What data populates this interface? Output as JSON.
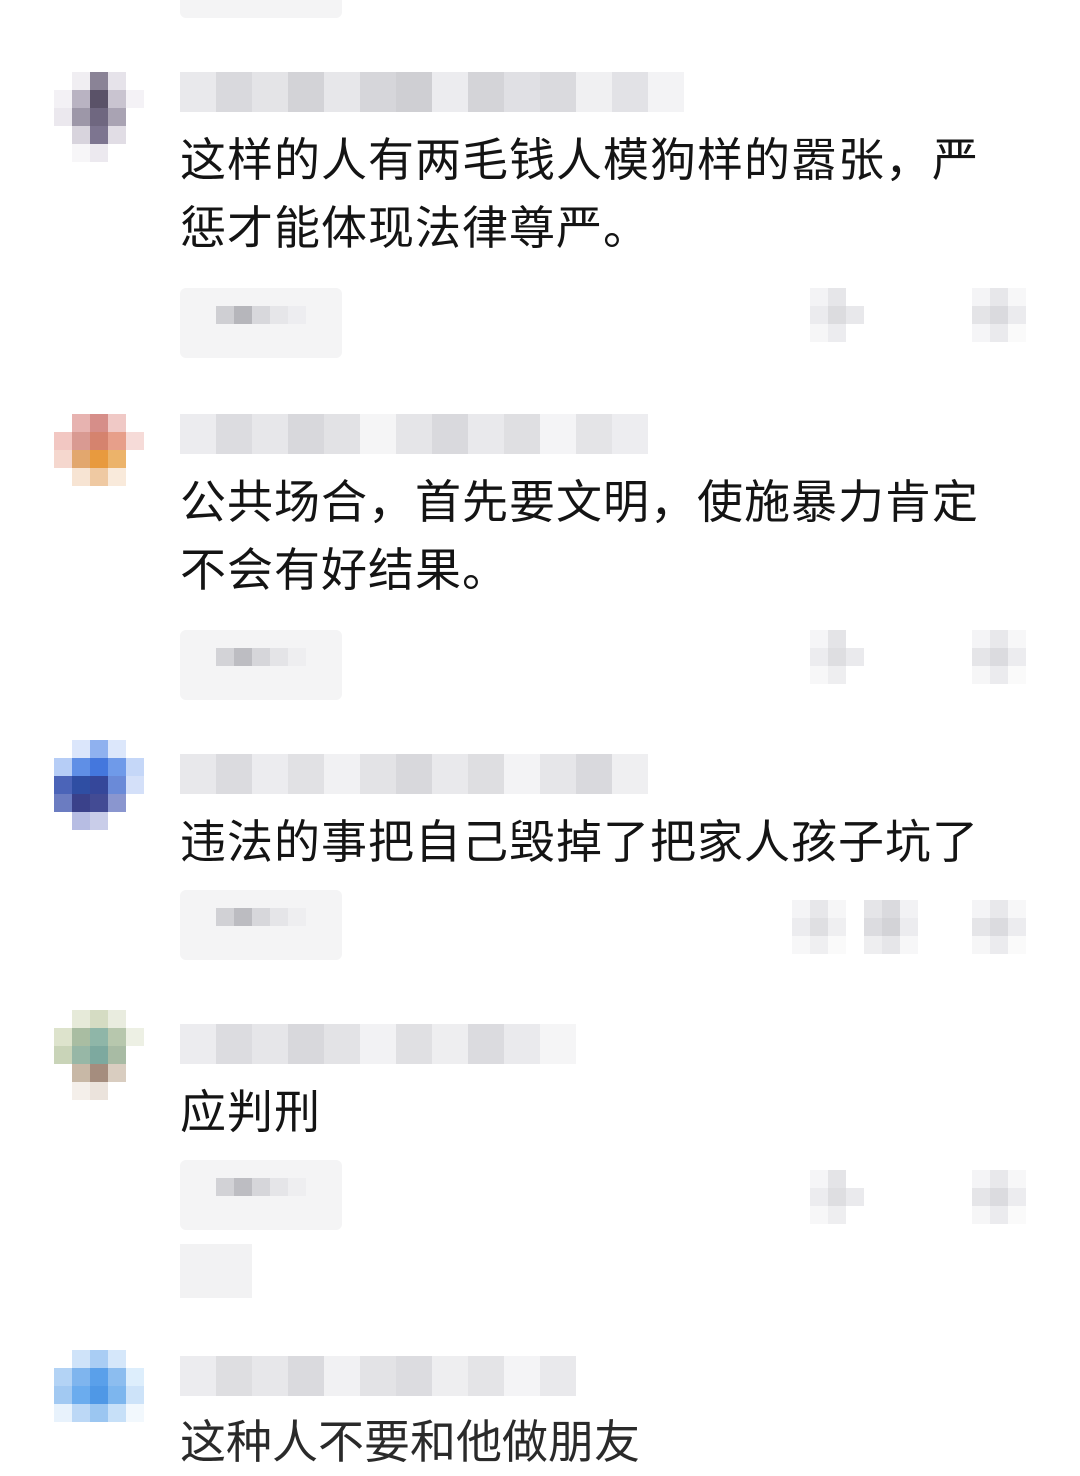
{
  "comments": [
    {
      "text_line1": "这样的人有两毛钱人模狗样的嚣张，严",
      "text_line2": "惩才能体现法律尊严。",
      "avatar_colors": [
        "#ffffff",
        "#f0eef2",
        "#8a8396",
        "#e6e3ea",
        "#ffffff",
        "#f3f1f5",
        "#b9b3c2",
        "#5a5268",
        "#c9c4d0",
        "#f4f2f6",
        "#ebe8ee",
        "#9d97a8",
        "#6f6780",
        "#a9a3b3",
        "#ffffff",
        "#ffffff",
        "#d8d4dd",
        "#7d7590",
        "#e1dde5",
        "#ffffff",
        "#ffffff",
        "#f7f6f8",
        "#ece9ef",
        "#ffffff",
        "#ffffff"
      ]
    },
    {
      "text_line1": "公共场合，首先要文明，使施暴力肯定",
      "text_line2": "不会有好结果。",
      "avatar_colors": [
        "#ffffff",
        "#e7b3b0",
        "#d68e89",
        "#f0c9c6",
        "#ffffff",
        "#f2c7c2",
        "#d99a92",
        "#d5836e",
        "#e79f8a",
        "#f6dbd8",
        "#f5d7ce",
        "#e2a76e",
        "#e89a3e",
        "#ecb36a",
        "#ffffff",
        "#ffffff",
        "#f7e4d3",
        "#efc9a2",
        "#f9eadb",
        "#ffffff",
        "#ffffff",
        "#ffffff",
        "#ffffff",
        "#ffffff",
        "#ffffff"
      ]
    },
    {
      "text_line1": "违法的事把自己毁掉了把家人孩子坑了",
      "text_line2": "",
      "avatar_colors": [
        "#ffffff",
        "#dbe6fb",
        "#8fb1ef",
        "#dce7fb",
        "#ffffff",
        "#b6cdf6",
        "#5f8fe6",
        "#4477dd",
        "#6f9ae9",
        "#c5d7f8",
        "#4b64b8",
        "#2f4ea3",
        "#35479a",
        "#6a8ad8",
        "#d4e0f9",
        "#6b7cc1",
        "#3a418a",
        "#434b94",
        "#8a96cf",
        "#ffffff",
        "#ffffff",
        "#b7bde3",
        "#c9cde9",
        "#ffffff",
        "#ffffff"
      ]
    },
    {
      "text_line1": "应判刑",
      "text_line2": "",
      "avatar_colors": [
        "#ffffff",
        "#e6ead9",
        "#d5dcc3",
        "#e9ecdf",
        "#ffffff",
        "#dde3cc",
        "#a9bda2",
        "#8fb6a8",
        "#b7c7ad",
        "#edf0e4",
        "#c9d4b8",
        "#97b7a6",
        "#7da99f",
        "#a8bba4",
        "#ffffff",
        "#ffffff",
        "#c8b8a6",
        "#a58d7e",
        "#d9cdc0",
        "#ffffff",
        "#ffffff",
        "#f4efea",
        "#ebe3dc",
        "#ffffff",
        "#ffffff"
      ]
    },
    {
      "text_line1": "这种人不要和他做朋友",
      "text_line2": "",
      "avatar_colors": [
        "#ffffff",
        "#cfe3f9",
        "#a9cdf4",
        "#d5e7fa",
        "#ffffff",
        "#b3d3f5",
        "#7fb5ee",
        "#5aa0ea",
        "#8cbdef",
        "#ddeefc",
        "#a2c9f2",
        "#6bacee",
        "#4f98e6",
        "#7db6ee",
        "#cde3f9",
        "#e8f2fc",
        "#bcd8f6",
        "#9bc6f1",
        "#c7e0f8",
        "#f2f8fd",
        "#ffffff",
        "#ffffff",
        "#ffffff",
        "#ffffff",
        "#ffffff"
      ]
    }
  ],
  "blur_colors": {
    "light": "#f1f1f3",
    "mid": "#e3e3e6",
    "dark": "#cfcfd3",
    "darker": "#b9b9be"
  }
}
